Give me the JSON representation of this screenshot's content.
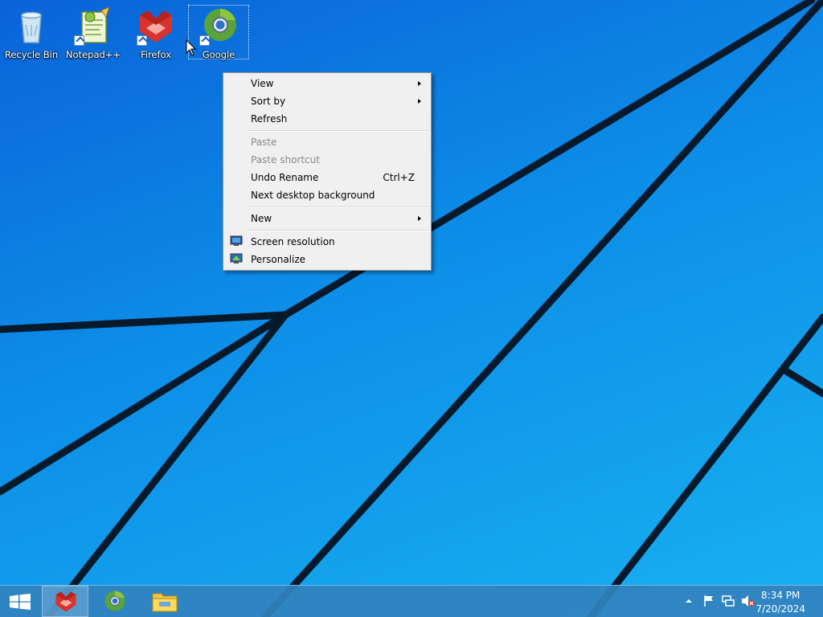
{
  "desktop": {
    "icons": [
      {
        "label": "Recycle Bin",
        "icon": "recycle-bin-icon"
      },
      {
        "label": "Notepad++",
        "icon": "notepad-plus-plus-icon"
      },
      {
        "label": "Firefox",
        "icon": "firefox-icon"
      },
      {
        "label": "Google",
        "icon": "google-chrome-icon",
        "selected": true
      }
    ]
  },
  "context_menu": {
    "items": [
      {
        "label": "View",
        "submenu": true
      },
      {
        "label": "Sort by",
        "submenu": true
      },
      {
        "label": "Refresh"
      },
      {
        "label": "Paste",
        "disabled": true
      },
      {
        "label": "Paste shortcut",
        "disabled": true
      },
      {
        "label": "Undo Rename",
        "shortcut": "Ctrl+Z"
      },
      {
        "label": "Next desktop background"
      },
      {
        "label": "New",
        "submenu": true
      },
      {
        "label": "Screen resolution",
        "icon": "screen-resolution-icon"
      },
      {
        "label": "Personalize",
        "icon": "personalize-icon"
      }
    ]
  },
  "taskbar": {
    "start_icon": "windows-logo-icon",
    "pinned": [
      {
        "icon": "firefox-icon",
        "active": true
      },
      {
        "icon": "google-chrome-icon"
      },
      {
        "icon": "file-explorer-icon"
      }
    ],
    "tray_icons": [
      "show-hidden-icons-icon",
      "action-center-flag-icon",
      "network-icon",
      "volume-muted-icon"
    ],
    "clock": {
      "time": "8:34 PM",
      "date": "7/20/2024"
    }
  },
  "colors": {
    "accent": "#1a8fe3",
    "taskbar": "#3282be",
    "menu_bg": "#f0f0f0"
  }
}
